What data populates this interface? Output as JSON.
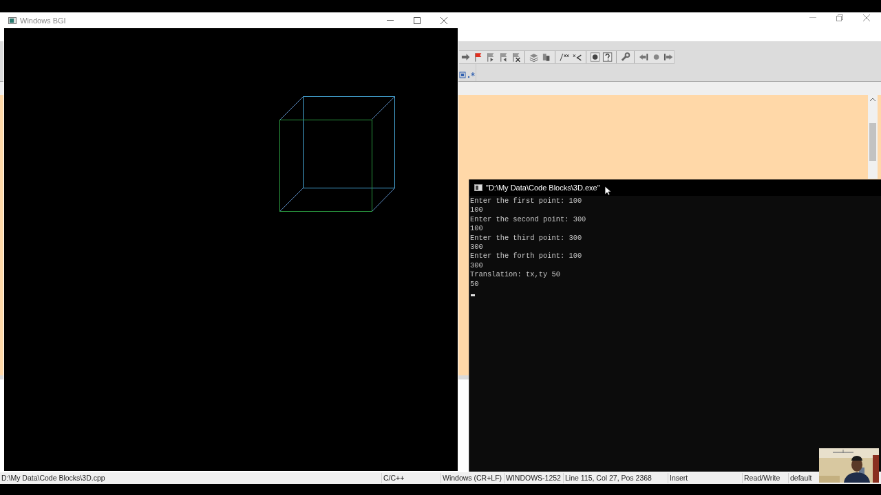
{
  "bgi_window": {
    "title": "Windows BGI"
  },
  "console": {
    "title": "\"D:\\My Data\\Code Blocks\\3D.exe\"",
    "lines": [
      "Enter the first point: 100",
      "100",
      "Enter the second point: 300",
      "100",
      "Enter the third point: 300",
      "300",
      "Enter the forth point: 100",
      "300",
      "Translation: tx,ty 50",
      "50"
    ]
  },
  "status_bar": [
    "D:\\My Data\\Code Blocks\\3D.cpp",
    "C/C++",
    "Windows (CR+LF)",
    "WINDOWS-1252",
    "Line 115, Col 27, Pos 2368",
    "Insert",
    "Read/Write",
    "default"
  ]
}
